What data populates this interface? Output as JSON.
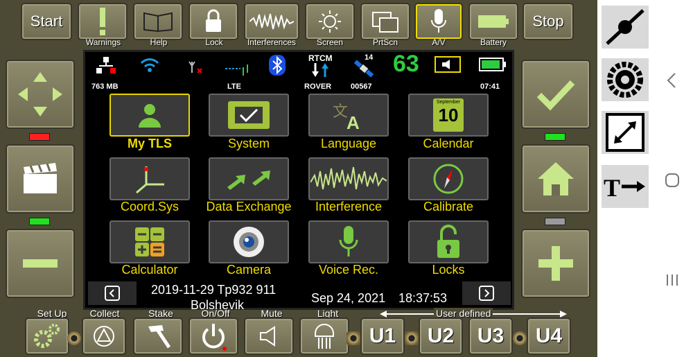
{
  "top_buttons": {
    "start": "Start",
    "stop": "Stop"
  },
  "top_labels": {
    "warnings": "Warnings",
    "help": "Help",
    "lock": "Lock",
    "interferences": "Interferences",
    "screen": "Screen",
    "prtscn": "PrtScn",
    "av": "A/V",
    "battery": "Battery"
  },
  "status": {
    "memory": "763 MB",
    "network": "LTE",
    "rtcm": "RTCM",
    "mode": "ROVER",
    "sat_count": "14",
    "sat_id": "00567",
    "signal": "63",
    "time": "07:41"
  },
  "tiles": [
    {
      "label": "My TLS",
      "selected": true
    },
    {
      "label": "System"
    },
    {
      "label": "Language"
    },
    {
      "label": "Calendar",
      "month": "September",
      "day": "10"
    },
    {
      "label": "Coord.Sys"
    },
    {
      "label": "Data Exchange"
    },
    {
      "label": "Interference"
    },
    {
      "label": "Calibrate"
    },
    {
      "label": "Calculator"
    },
    {
      "label": "Camera"
    },
    {
      "label": "Voice Rec."
    },
    {
      "label": "Locks"
    }
  ],
  "footer": {
    "project_line1": "2019-11-29 Tp932 911",
    "project_line2": "Bolshevik",
    "date": "Sep 24, 2021",
    "clock": "18:37:53"
  },
  "bottom_labels": {
    "setup": "Set Up",
    "collect": "Collect",
    "stake": "Stake",
    "onoff": "On/Off",
    "mute": "Mute",
    "light": "Light",
    "user_defined": "User defined"
  },
  "bottom_buttons": {
    "u1": "U1",
    "u2": "U2",
    "u3": "U3",
    "u4": "U4"
  },
  "colors": {
    "accent": "#f0dc00",
    "icon_green": "#c8e68a",
    "led_red": "#ff2020",
    "led_green": "#20e020"
  }
}
